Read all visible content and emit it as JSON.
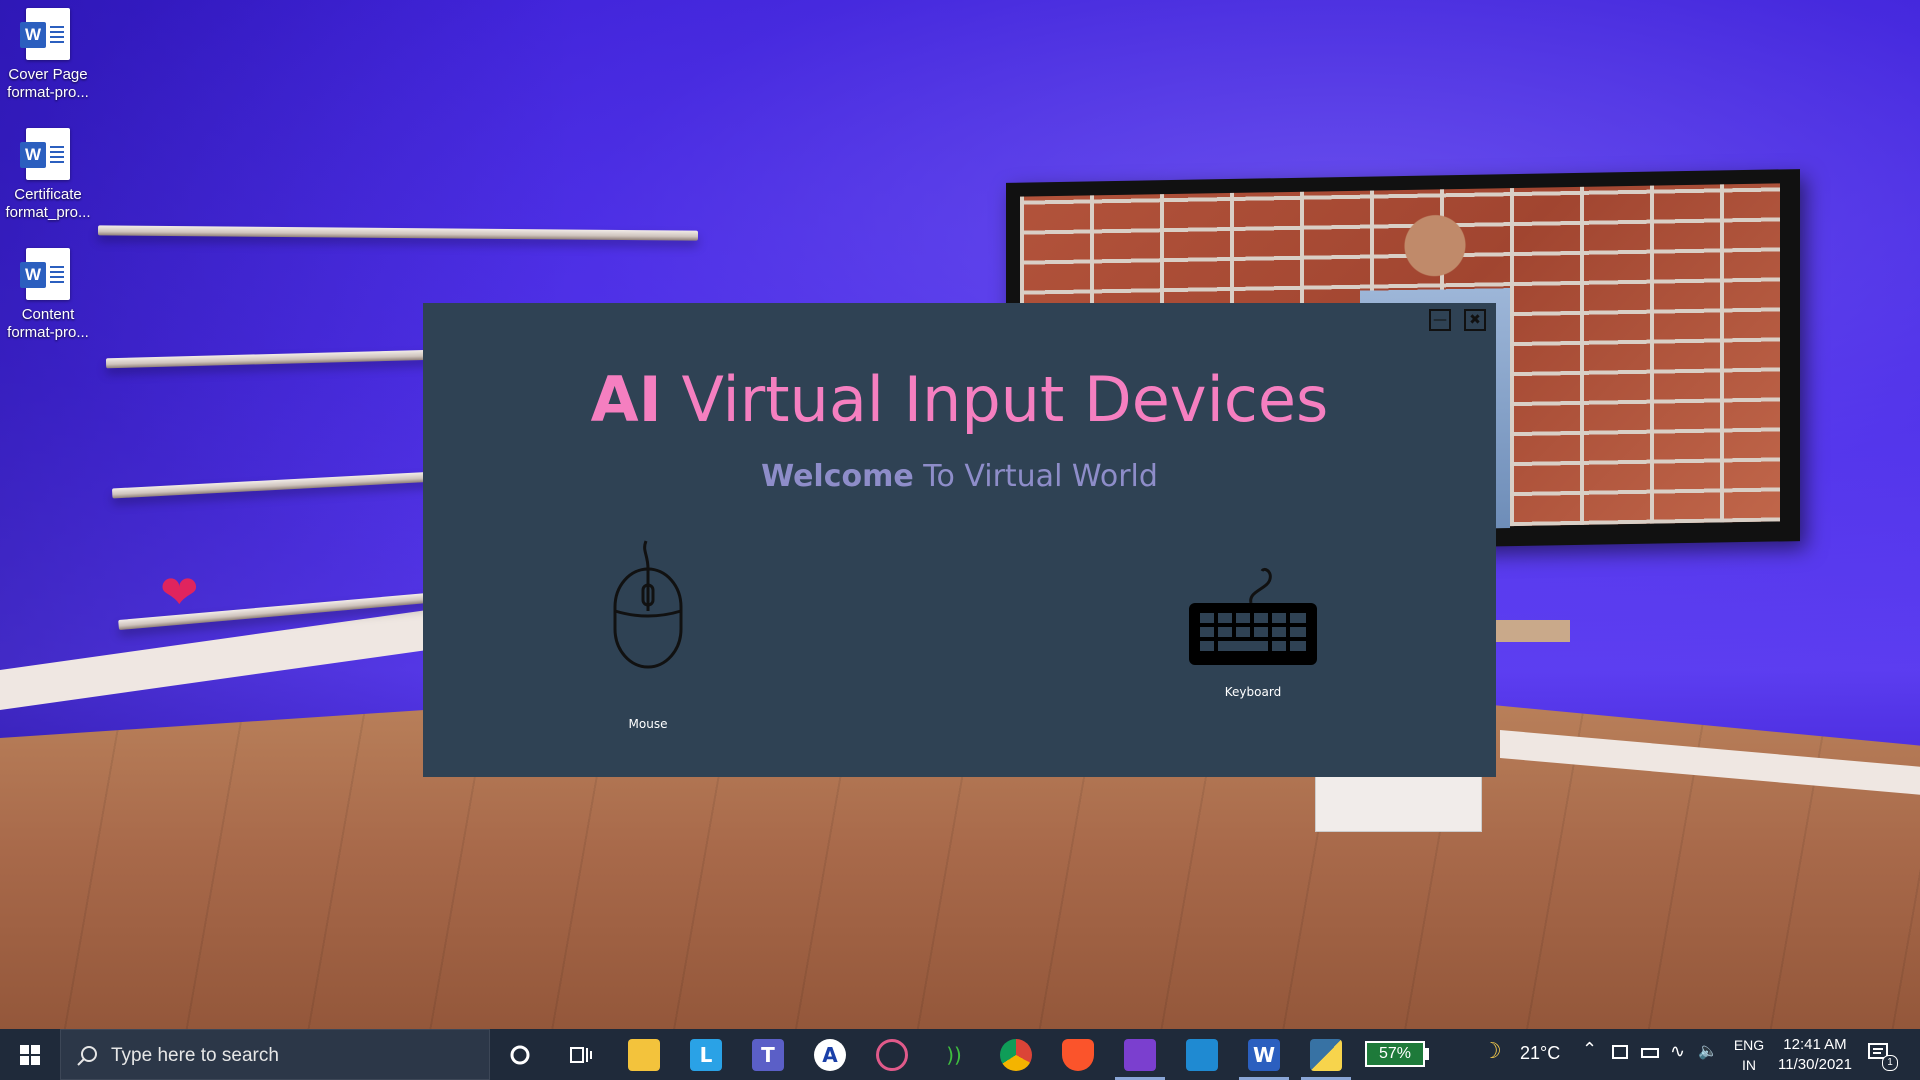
{
  "desktop": {
    "icons": [
      {
        "label_line1": "Cover Page",
        "label_line2": "format-pro...",
        "icon": "word-document-icon"
      },
      {
        "label_line1": "Certificate",
        "label_line2": "format_pro...",
        "icon": "word-document-icon"
      },
      {
        "label_line1": "Content",
        "label_line2": "format-pro...",
        "icon": "word-document-icon"
      }
    ],
    "word_glyph": "W"
  },
  "app": {
    "title_bold": "AI",
    "title_rest": " Virtual Input Devices",
    "subtitle_bold": "Welcome",
    "subtitle_rest": " To Virtual World",
    "minimize_glyph": "—",
    "close_glyph": "✖",
    "devices": [
      {
        "label": "Mouse",
        "icon": "mouse-icon"
      },
      {
        "label": "Keyboard",
        "icon": "keyboard-icon"
      }
    ],
    "colors": {
      "background": "#2f4254",
      "title": "#f57fc0",
      "subtitle": "#8e8dc9"
    }
  },
  "taskbar": {
    "search_placeholder": "Type here to search",
    "pinned": [
      "cortana-icon",
      "task-view-icon",
      "file-explorer-icon",
      "l-app-icon",
      "teams-icon",
      "w-app-icon",
      "media-app-icon",
      "network-app-icon",
      "chrome-icon",
      "brave-icon",
      "visual-studio-icon",
      "vs-code-icon",
      "word-icon",
      "python-icon"
    ],
    "battery_percent": "57%",
    "weather_temp": "21°C",
    "language_line1": "ENG",
    "language_line2": "IN",
    "time": "12:41 AM",
    "date": "11/30/2021",
    "notification_count": "1"
  }
}
